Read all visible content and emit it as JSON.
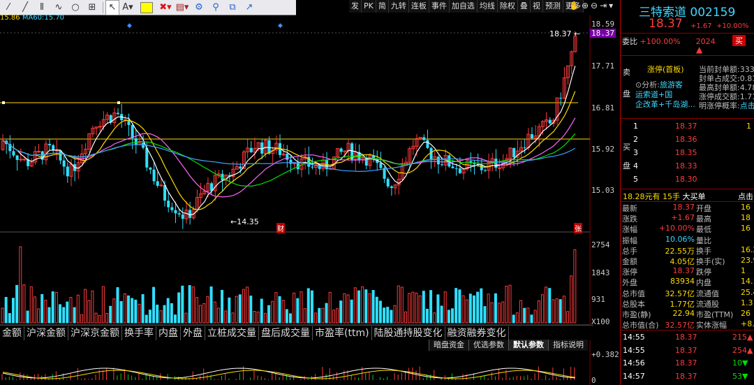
{
  "toolbar": {
    "icons": [
      "pointer-icon",
      "line-icon",
      "bars-icon",
      "wave-icon",
      "circle-icon",
      "grid-icon",
      "cursor-icon",
      "text-icon",
      "color-swatch",
      "delete-icon",
      "mark-icon",
      "gear-icon",
      "zoom-icon",
      "layout-icon",
      "share-icon"
    ],
    "color": "#ffff00"
  },
  "topright": {
    "items": [
      "发",
      "PK",
      "简",
      "九转",
      "连板",
      "事件",
      "加自选",
      "均线",
      "除权",
      "叠",
      "视",
      "预测",
      "更多"
    ]
  },
  "ma_label": {
    "ma30": "15.86",
    "ma60_name": "MA60:",
    "ma60": "15.70"
  },
  "price_axis": [
    "18.59",
    "18.37",
    "17.71",
    "16.81",
    "15.92",
    "15.03"
  ],
  "price_flags": {
    "high_label": "18.37",
    "low_label": "14.35",
    "cai": "财",
    "zhang": "张"
  },
  "vol_axis": [
    "2754",
    "1843",
    "931",
    "X100"
  ],
  "macd_axis": [
    "+0.382",
    "0"
  ],
  "tabs": [
    "金额",
    "沪深金额",
    "沪深京金额",
    "换手率",
    "内盘",
    "外盘",
    "立桩成交量",
    "盘后成交量",
    "市盈率(ttm)",
    "陆股通持股变化",
    "融资融券变化"
  ],
  "buttons": [
    "暗盘资金",
    "优选参数",
    "默认参数",
    "指标说明"
  ],
  "stock": {
    "name": "三特索道",
    "code": "002159",
    "price": "18.37",
    "chg": "+1.67",
    "pct": "+10.00%"
  },
  "weibi": {
    "label": "委比",
    "value": "+100.00%",
    "vol": "2024",
    "sell_label": "买",
    "rise": "涨"
  },
  "sell_side": {
    "label": "卖",
    "label2": "盘",
    "limit": "涨停(首板)",
    "analysis": "分析:",
    "tag1": "旅游客",
    "tag2": "运索道+国",
    "tag3": "企改革+千岛湖...",
    "r1": "当前封单额:333.",
    "r2": "封单占成交:0.81",
    "r3": "最高封单额:4.78",
    "r4": "涨停成交额:1.71",
    "r5": "明涨停概率:",
    "r5v": "点击"
  },
  "buy_side": {
    "label": "买",
    "label2": "盘",
    "levels": [
      {
        "n": "1",
        "p": "18.37",
        "v": "1"
      },
      {
        "n": "2",
        "p": "18.36",
        "v": ""
      },
      {
        "n": "3",
        "p": "18.35",
        "v": ""
      },
      {
        "n": "4",
        "p": "18.33",
        "v": ""
      },
      {
        "n": "5",
        "p": "18.30",
        "v": ""
      }
    ]
  },
  "bigorder": {
    "price": "18.28元有",
    "hands": "15手",
    "text": "大买单",
    "click": "点击"
  },
  "quote": [
    {
      "k1": "最新",
      "v1": "18.37",
      "k2": "开盘",
      "v2": "16"
    },
    {
      "k1": "涨跌",
      "v1": "+1.67",
      "k2": "最高",
      "v2": "18"
    },
    {
      "k1": "涨幅",
      "v1": "+10.00%",
      "k2": "最低",
      "v2": "16"
    },
    {
      "k1": "振幅",
      "v1": "10.06%",
      "k2": "量比",
      "v2": ""
    },
    {
      "k1": "总手",
      "v1": "22.55万",
      "k2": "换手",
      "v2": "16.2"
    },
    {
      "k1": "金额",
      "v1": "4.05亿",
      "k2": "换手(实)",
      "v2": "23.9"
    },
    {
      "k1": "涨停",
      "v1": "18.37",
      "k2": "跌停",
      "v2": "1"
    },
    {
      "k1": "外盘",
      "v1": "83934",
      "k2": "内盘",
      "v2": "14.1"
    },
    {
      "k1": "总市值",
      "v1": "32.57亿",
      "k2": "流通值",
      "v2": "25.4"
    },
    {
      "k1": "总股本",
      "v1": "1.77亿",
      "k2": "流通股",
      "v2": "1.3"
    },
    {
      "k1": "市盈(静)",
      "v1": "22.94",
      "k2": "市盈(TTM)",
      "v2": "26"
    },
    {
      "k1": "总市值(合)",
      "v1": "32.57亿",
      "k2": "实体涨幅",
      "v2": "+8.6"
    }
  ],
  "ticks": [
    {
      "t": "14:55",
      "p": "18.37",
      "v": "215"
    },
    {
      "t": "14:55",
      "p": "18.37",
      "v": "254"
    },
    {
      "t": "14:56",
      "p": "18.37",
      "v": "10"
    },
    {
      "t": "14:57",
      "p": "18.37",
      "v": "53"
    }
  ]
}
